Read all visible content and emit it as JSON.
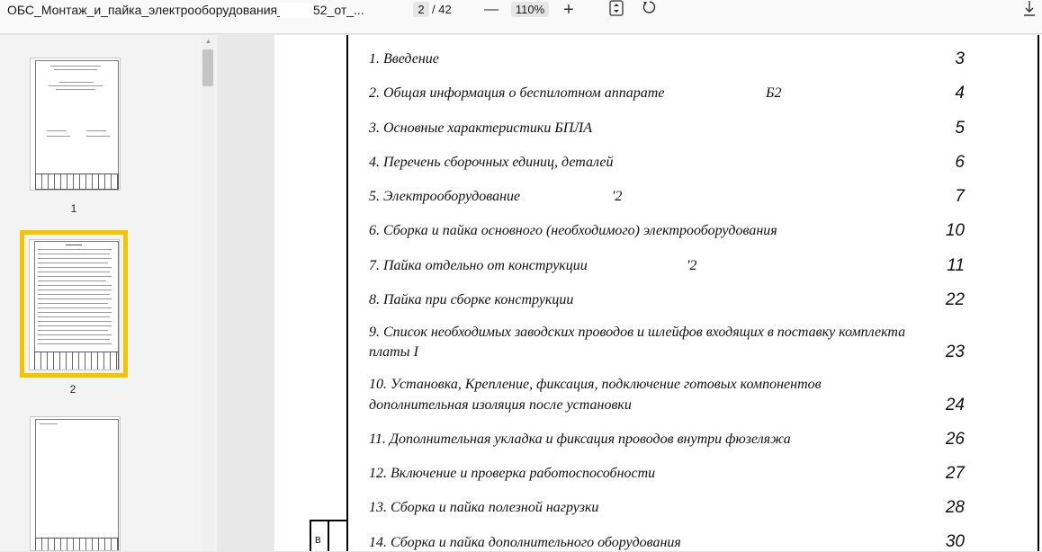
{
  "toolbar": {
    "doc_title": "ОБС_Монтаж_и_пайка_электрооборудования_",
    "doc_title_end": "52_от_...",
    "current_page": "2",
    "page_total": "/ 42",
    "zoom": "110%",
    "icons": [
      "zoom-out-icon",
      "zoom-in-icon",
      "fit-page-icon",
      "rotate-icon",
      "download-icon"
    ]
  },
  "thumbnails": [
    {
      "label": "1"
    },
    {
      "label": "2",
      "selected": true
    },
    {
      "label": ""
    }
  ],
  "toc": [
    {
      "title": "1. Введение",
      "page": "3"
    },
    {
      "title": "2. Общая информация о беспилотном аппарате",
      "title_tail": "Б2",
      "page": "4"
    },
    {
      "title": "3. Основные характеристики БПЛА",
      "page": "5"
    },
    {
      "title": "4. Перечень сборочных единиц, деталей",
      "page": "6"
    },
    {
      "title": "5. Электрооборудование",
      "title_tail": "'2",
      "page": "7"
    },
    {
      "title": "6. Сборка и пайка основного (необходимого) электрооборудования",
      "page": "10"
    },
    {
      "title": "7. Пайка отдельно от конструкции",
      "title_tail": "'2",
      "page": "11"
    },
    {
      "title": "8. Пайка при сборке конструкции",
      "page": "22"
    },
    {
      "title": "9. Список необходимых заводских проводов и шлейфов входящих в поставку комплекта",
      "title_line2": "платы I",
      "page": "23"
    },
    {
      "title": "10. Установка, Крепление, фиксация, подключение готовых компонентов",
      "title_line2": "дополнительная изоляция после установки",
      "page": "24"
    },
    {
      "title": "11. Дополнительная укладка и фиксация проводов внутри фюзеляжа",
      "page": "26"
    },
    {
      "title": "12. Включение и проверка работоспособности",
      "page": "27"
    },
    {
      "title": "13. Сборка и пайка полезной нагрузки",
      "page": "28"
    },
    {
      "title": "14. Сборка и пайка дополнительного оборудования",
      "page": "30"
    }
  ]
}
